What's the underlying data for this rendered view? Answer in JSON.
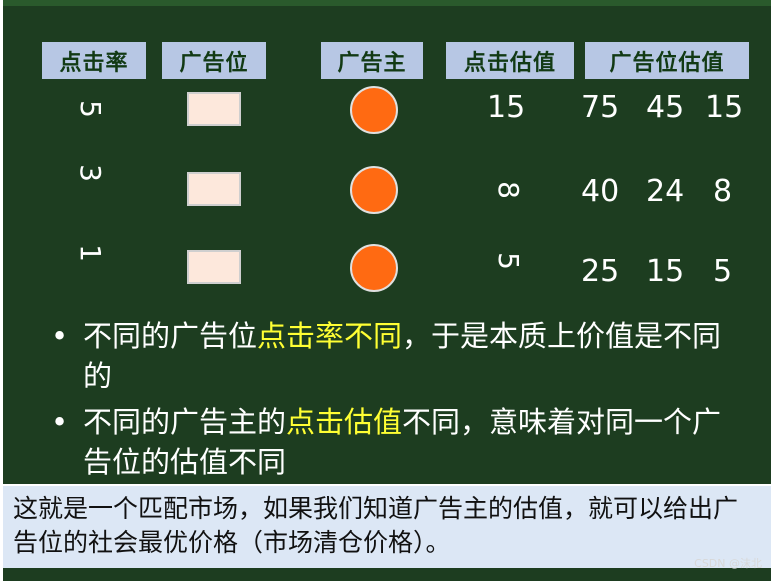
{
  "headers": {
    "ctr": "点击率",
    "slot": "广告位",
    "advertiser": "广告主",
    "click_value": "点击估值",
    "slot_value": "广告位估值"
  },
  "rows": [
    {
      "ctr": "5",
      "click_value": "15",
      "slot_values": [
        "75",
        "45",
        "15"
      ]
    },
    {
      "ctr": "3",
      "click_value": "8",
      "slot_values": [
        "40",
        "24",
        "8"
      ]
    },
    {
      "ctr": "1",
      "click_value": "5",
      "slot_values": [
        "25",
        "15",
        "5"
      ]
    }
  ],
  "bullets": [
    {
      "pre": "不同的广告位",
      "highlight": "点击率不同",
      "post": "，于是本质上价值是不同的"
    },
    {
      "pre": "不同的广告主的",
      "highlight": "点击估值",
      "post": "不同，意味着对同一个广告位的估值不同"
    }
  ],
  "bullet_symbol": "•",
  "note": "这就是一个匹配市场，如果我们知道广告主的估值，就可以给出广告位的社会最优价格（市场清仓价格）。",
  "watermark": "CSDN @沫北",
  "colors": {
    "background": "#1d3d20",
    "header_bg": "#b7c7e4",
    "advertiser_circle": "#ff6a12",
    "slot_box": "#fde8dc",
    "highlight": "#ffff33",
    "note_bg": "#dce7f5"
  }
}
